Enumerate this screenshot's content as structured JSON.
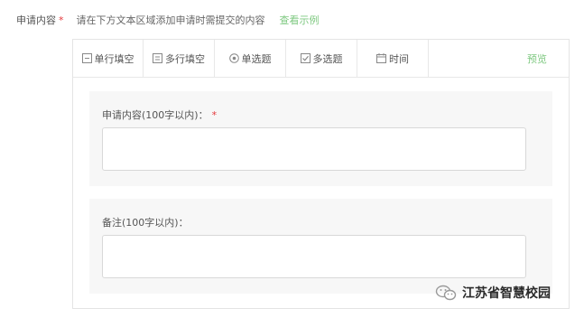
{
  "field": {
    "label": "申请内容",
    "required_mark": "*",
    "description": "请在下方文本区域添加申请时需提交的内容",
    "example_link": "查看示例"
  },
  "toolbar": {
    "items": [
      {
        "label": "单行填空",
        "icon": "single-line-icon"
      },
      {
        "label": "多行填空",
        "icon": "multi-line-icon"
      },
      {
        "label": "单选题",
        "icon": "radio-icon"
      },
      {
        "label": "多选题",
        "icon": "checkbox-icon"
      },
      {
        "label": "时间",
        "icon": "calendar-icon"
      }
    ],
    "preview_label": "预览"
  },
  "form": {
    "fields": [
      {
        "label": "申请内容(100字以内)：",
        "required_mark": "*",
        "value": ""
      },
      {
        "label": "备注(100字以内)：",
        "value": ""
      }
    ]
  },
  "watermark": {
    "icon": "wechat-icon",
    "text": "江苏省智慧校园"
  },
  "colors": {
    "accent_green": "#7ec880",
    "required_red": "#e4393c",
    "card_bg": "#f7f7f7",
    "border": "#e4e4e4"
  }
}
